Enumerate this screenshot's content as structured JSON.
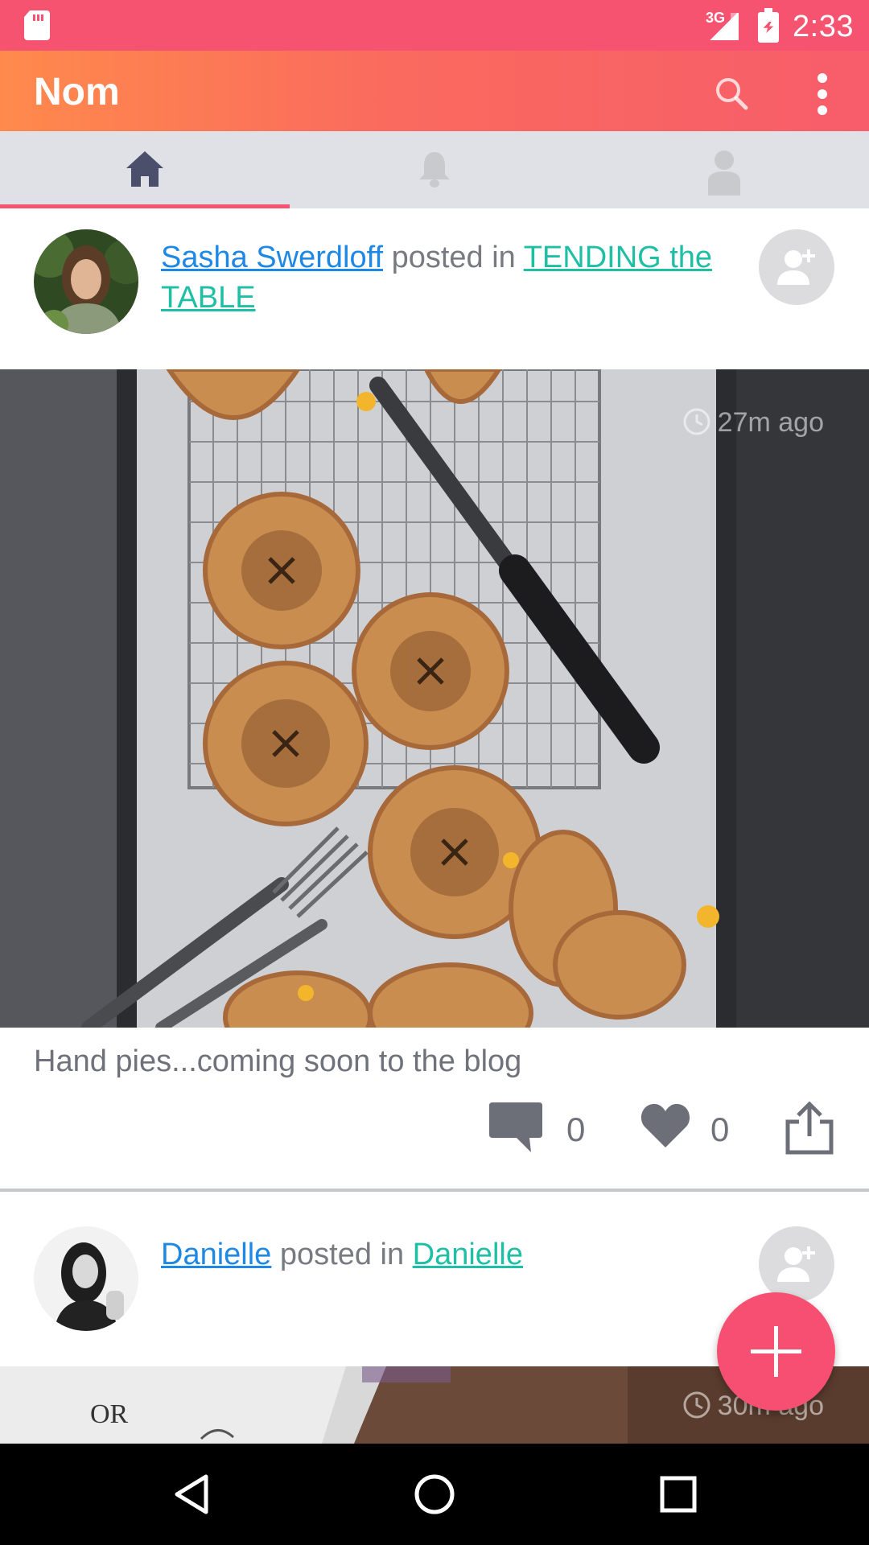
{
  "status_bar": {
    "network_type": "3G",
    "time": "2:33",
    "icons": [
      "sd-card-icon",
      "signal-icon",
      "battery-charging-icon"
    ]
  },
  "app_bar": {
    "title": "Nom",
    "actions": [
      "search-icon",
      "more-vert-icon"
    ]
  },
  "tabs": [
    {
      "icon": "home-icon",
      "selected": true
    },
    {
      "icon": "bell-icon",
      "selected": false
    },
    {
      "icon": "person-icon",
      "selected": false
    }
  ],
  "posts": [
    {
      "author": "Sasha Swerdloff",
      "connector": " posted in ",
      "channel": "TENDING the TABLE",
      "timestamp": "27m ago",
      "caption": "Hand pies...coming soon to the blog",
      "comments": "0",
      "likes": "0"
    },
    {
      "author": "Danielle",
      "connector": " posted in ",
      "channel": "Danielle",
      "timestamp": "30m ago"
    }
  ],
  "colors": {
    "status_bar": "#f5536f",
    "app_bar_start": "#ff8a4c",
    "app_bar_end": "#f75d6a",
    "accent": "#f5536f",
    "author_link": "#1e88e5",
    "channel_link": "#1fbfa6",
    "fab": "#f74f72"
  }
}
